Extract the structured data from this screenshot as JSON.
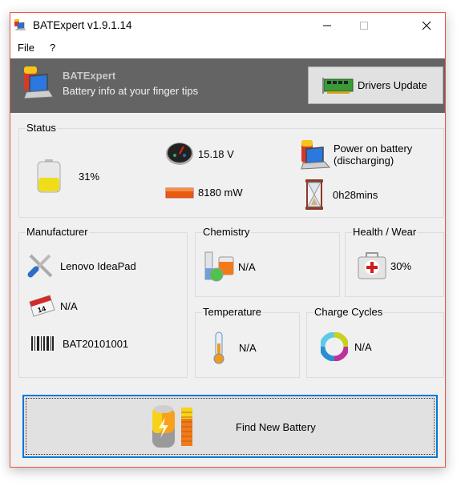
{
  "window": {
    "title": "BATExpert v1.9.1.14",
    "controls": {
      "minimize": "minimize",
      "maximize": "maximize",
      "close": "close"
    }
  },
  "menu": {
    "items": [
      {
        "label": "File"
      },
      {
        "label": "?"
      }
    ]
  },
  "banner": {
    "title": "BATExpert",
    "subtitle": "Battery info at your finger tips",
    "drivers_button": "Drivers Update"
  },
  "status": {
    "title": "Status",
    "charge_percent": "31%",
    "charge_fraction": 0.31,
    "voltage": "15.18 V",
    "power": "8180 mW",
    "power_source": "Power on battery\n(discharging)",
    "time_remaining": "0h28mins"
  },
  "manufacturer": {
    "title": "Manufacturer",
    "name": "Lenovo IdeaPad",
    "date": "N/A",
    "serial": "BAT20101001"
  },
  "chemistry": {
    "title": "Chemistry",
    "value": "N/A"
  },
  "health": {
    "title": "Health / Wear",
    "value": "30%"
  },
  "temperature": {
    "title": "Temperature",
    "value": "N/A"
  },
  "cycles": {
    "title": "Charge Cycles",
    "value": "N/A"
  },
  "find_button": {
    "label": "Find New Battery"
  },
  "colors": {
    "accent": "#0078d7",
    "window_border": "#e8534a",
    "banner_bg": "#646464"
  }
}
